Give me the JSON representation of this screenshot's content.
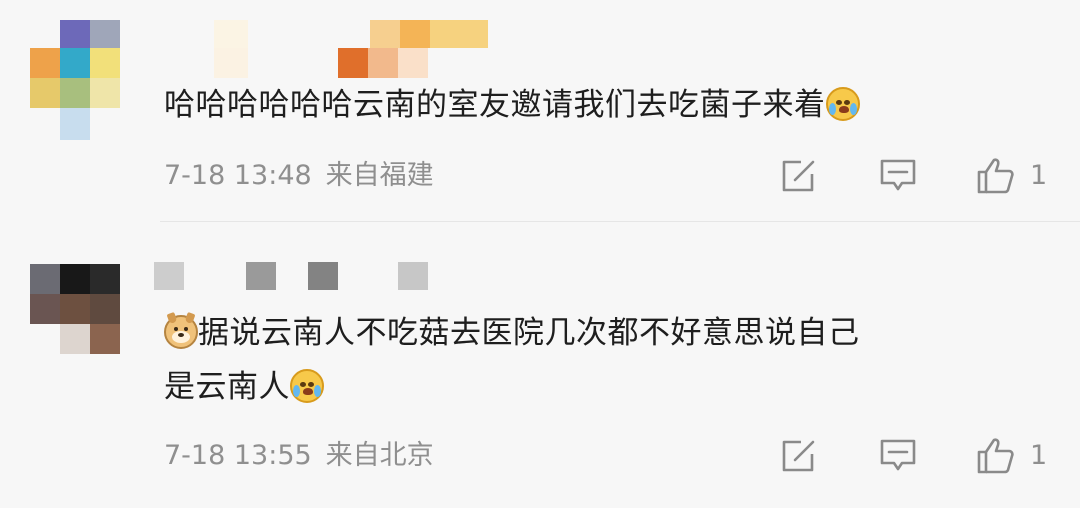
{
  "comments": [
    {
      "text": "哈哈哈哈哈哈云南的室友邀请我们去吃菌子来着",
      "emoji_end": "crying-face-emoji",
      "time": "7-18 13:48",
      "location": "来自福建",
      "likes": "1"
    },
    {
      "emoji_start": "doge-emoji",
      "text_line1": "据说云南人不吃菇去医院几次都不好意思说自己",
      "text_line2": "是云南人",
      "emoji_end": "laughing-crying-emoji",
      "time": "7-18 13:55",
      "location": "来自北京",
      "likes": "1"
    }
  ],
  "icons": {
    "share": "share-edit-icon",
    "comment": "comment-icon",
    "like": "thumbs-up-icon"
  },
  "colors": {
    "background": "#f7f7f7",
    "text": "#1e1e1e",
    "meta": "#8f8f8f",
    "divider": "#e6e6e6"
  }
}
